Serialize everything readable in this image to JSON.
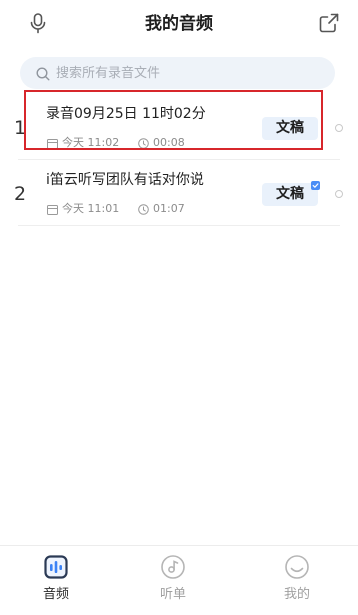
{
  "header": {
    "title": "我的音频",
    "left_icon": "microphone-icon",
    "right_icon": "export-icon"
  },
  "search": {
    "placeholder": "搜索所有录音文件",
    "icon": "search-icon"
  },
  "recordings": [
    {
      "index": "1",
      "title": "录音09月25日 11时02分",
      "date": "今天 11:02",
      "duration": "00:08",
      "transcript_label": "文稿",
      "transcript_badge": false,
      "highlighted": true
    },
    {
      "index": "2",
      "title": "i笛云听写团队有话对你说",
      "date": "今天 11:01",
      "duration": "01:07",
      "transcript_label": "文稿",
      "transcript_badge": true,
      "highlighted": false
    }
  ],
  "tabbar": {
    "items": [
      {
        "label": "音频",
        "icon": "audio-waveform-icon",
        "active": true
      },
      {
        "label": "听单",
        "icon": "music-disc-icon",
        "active": false
      },
      {
        "label": "我的",
        "icon": "profile-icon",
        "active": false
      }
    ]
  },
  "colors": {
    "background": "#ffffff",
    "text_primary": "#222222",
    "text_secondary": "#8c8c8c",
    "search_bg": "#eef3f9",
    "transcript_button_bg": "#e9f1fb",
    "accent": "#3b82f5",
    "highlight_border": "#d7262b",
    "tab_inactive": "#a0a0a0"
  }
}
